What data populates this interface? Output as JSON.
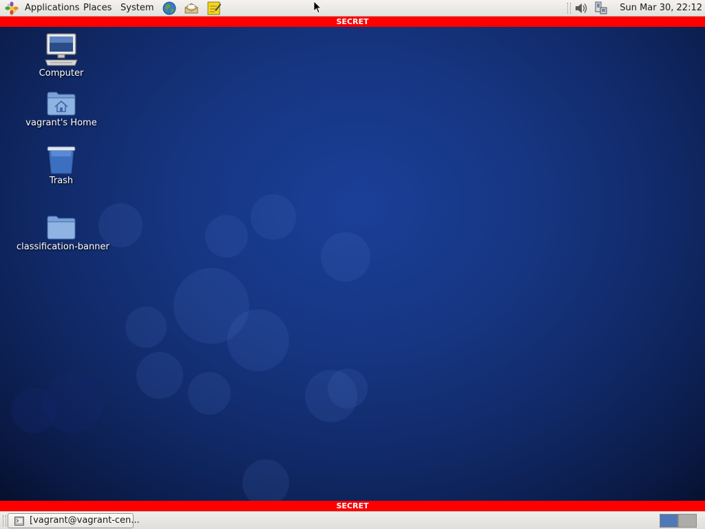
{
  "top_panel": {
    "menus": {
      "applications": "Applications",
      "places": "Places",
      "system": "System"
    },
    "launchers": [
      "web-browser-icon",
      "email-client-icon",
      "notes-icon"
    ],
    "tray": [
      "volume-icon",
      "network-icon"
    ],
    "clock": "Sun Mar 30, 22:12"
  },
  "classification": {
    "top_label": "SECRET",
    "bottom_label": "SECRET",
    "color": "#ff0000",
    "text_color": "#ffffff"
  },
  "desktop": {
    "icons": [
      {
        "label": "Computer",
        "icon": "computer-icon"
      },
      {
        "label": "vagrant's Home",
        "icon": "home-folder-icon"
      },
      {
        "label": "Trash",
        "icon": "trash-icon"
      },
      {
        "label": "classification-banner",
        "icon": "folder-icon"
      }
    ]
  },
  "bottom_panel": {
    "taskbar": [
      {
        "label": "[vagrant@vagrant-cen...",
        "icon": "terminal-icon"
      }
    ],
    "workspaces": {
      "count": 2,
      "active": 1
    }
  }
}
